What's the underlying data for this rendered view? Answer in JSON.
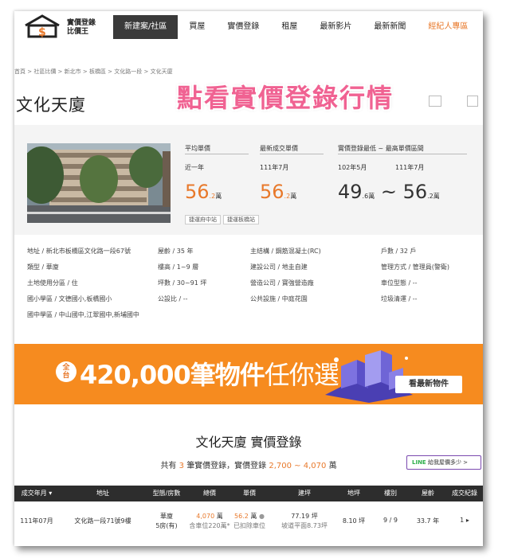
{
  "header": {
    "logo_line1": "實價登錄",
    "logo_line2": "比價王",
    "nav": [
      {
        "label": "新建案/社區"
      },
      {
        "label": "買屋"
      },
      {
        "label": "實價登錄"
      },
      {
        "label": "租屋"
      },
      {
        "label": "最新影片"
      },
      {
        "label": "最新新聞"
      },
      {
        "label": "經紀人專區"
      }
    ]
  },
  "breadcrumb": "首頁 > 社區比價 > 新北市 > 板橋區 > 文化路一段 > 文化天廈",
  "title": "文化天廈",
  "promo_text": "點看實價登錄行情",
  "summary": {
    "avg_label": "平均單價",
    "avg_sub": "近一年",
    "avg_value": "56",
    "avg_dec": ".2",
    "latest_label": "最新成交單價",
    "latest_sub": "111年7月",
    "latest_value": "56",
    "latest_dec": ".2",
    "range_label": "實價登錄最低 ~ 最高單價區間",
    "range_sub_low": "102年5月",
    "range_sub_high": "111年7月",
    "range_low": "49",
    "range_low_dec": ".6",
    "range_sep": "~",
    "range_high": "56",
    "range_high_dec": ".2",
    "unit": "萬",
    "tags": [
      "捷運府中站",
      "捷運板橋站"
    ]
  },
  "details": [
    "地址 / 新北市板橋區文化路一段67號",
    "屋齡 / 35 年",
    "主结構 / 鋼筋混凝土(RC)",
    "戶數 / 32 戶",
    "類型 / 華廈",
    "樓高 / 1~9 層",
    "建設公司 / 地圭自建",
    "管理方式 / 管理員(警衛)",
    "土地使用分區 / 住",
    "坪數 / 30~91 坪",
    "營造公司 / 寶強營造廠",
    "車位型態 / --",
    "國小學區 / 文德國小,板橋國小",
    "公設比 / --",
    "公共設施 / 中庭花園",
    "垃圾清運 / --",
    "國中學區 / 中山國中,江翠國中,新埔國中"
  ],
  "ad": {
    "badge_top": "全",
    "badge_bottom": "台",
    "count": "420,000",
    "text_bold": "筆物件",
    "text_light": "任你選",
    "button": "看最新物件"
  },
  "section": {
    "title_name": "文化天廈",
    "title_suffix": "實價登錄",
    "sub_prefix": "共有",
    "sub_count": "3",
    "sub_mid": "筆實價登錄，實價登錄",
    "sub_range": "2,700 ~ 4,070",
    "sub_unit": "萬",
    "line_label": "LINE",
    "line_text": "給我屋價多少 >"
  },
  "table": {
    "headers": [
      "成交年月",
      "地址",
      "型態/房數",
      "總價",
      "單價",
      "建坪",
      "地坪",
      "樓別",
      "屋齡",
      "成交紀錄"
    ],
    "row": {
      "date": "111年07月",
      "address": "文化路一段71號9樓",
      "type1": "華廈",
      "type2": "5房(有)",
      "total": "4,070",
      "total_unit": "萬",
      "total_note": "含車位220萬*",
      "unit_price": "56.2",
      "unit_price_unit": "萬",
      "unit_note": "已扣除車位",
      "building": "77.19 坪",
      "building_note": "坡道平面8.73坪",
      "land": "8.10 坪",
      "floor": "9 / 9",
      "age": "33.7 年",
      "records": "1"
    }
  },
  "colors": {
    "accent": "#e8792b",
    "nav_active": "#3a3a3a",
    "promo": "#f06292",
    "ad_bg": "#f68b1f",
    "table_head": "#2d2d2d"
  }
}
